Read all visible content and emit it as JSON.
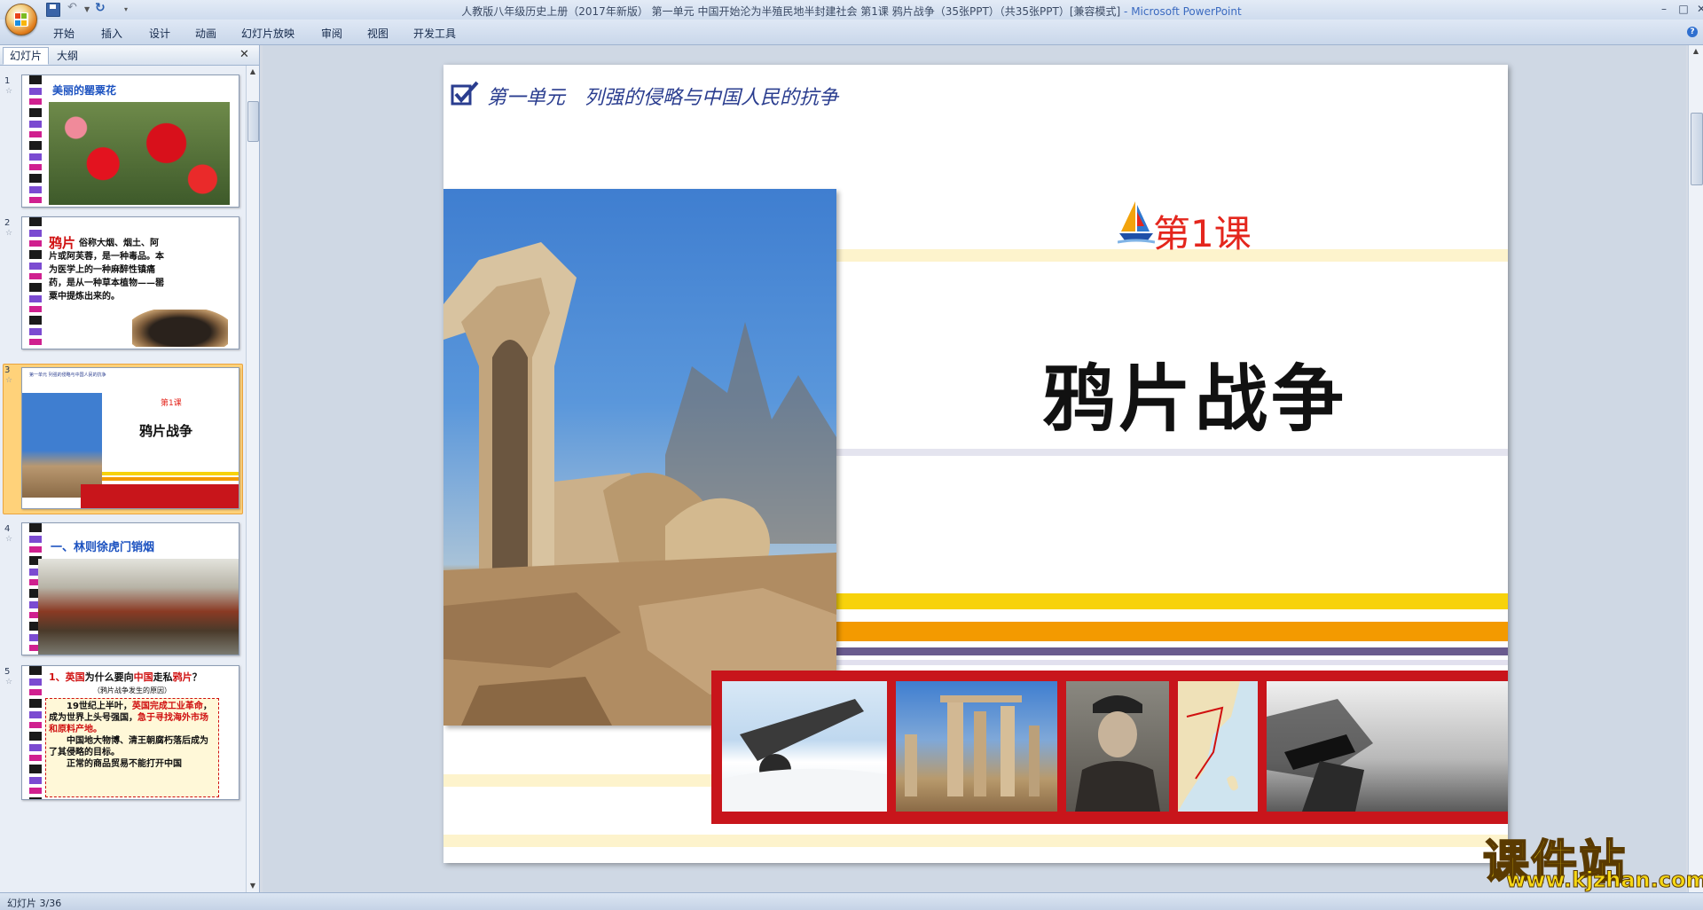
{
  "titlebar": {
    "title": "人教版八年级历史上册（2017年新版） 第一单元 中国开始沦为半殖民地半封建社会 第1课 鸦片战争（35张PPT）（共35张PPT）[兼容模式]",
    "app": " - Microsoft PowerPoint",
    "min": "–",
    "max": "□",
    "close": "✕"
  },
  "ribbon": {
    "tabs": [
      "开始",
      "插入",
      "设计",
      "动画",
      "幻灯片放映",
      "审阅",
      "视图",
      "开发工具"
    ]
  },
  "panel": {
    "tab_slides": "幻灯片",
    "tab_outline": "大纲",
    "close": "✕"
  },
  "thumbnails": [
    {
      "num": "1",
      "title": "美丽的罂粟花"
    },
    {
      "num": "2",
      "heading": "鸦片",
      "body": "俗称大烟、烟土、阿片或阿芙蓉，是一种毒品。本为医学上的一种麻醉性镇痛药，是从一种草本植物——罂粟中提炼出来的。"
    },
    {
      "num": "3",
      "unit": "第一单元 列强的侵略与中国人民的抗争",
      "lesson": "第1课",
      "title": "鸦片战争"
    },
    {
      "num": "4",
      "title": "一、林则徐虎门销烟"
    },
    {
      "num": "5",
      "q_num": "1、",
      "q_a": "英国",
      "q_b": "为什么要向",
      "q_c": "中国",
      "q_d": "走私",
      "q_e": "鸦片",
      "q_f": "？",
      "sub": "（鸦片战争发生的原因）",
      "p1a": "19世纪上半叶，",
      "p1b": "英国完成工业革命",
      "p1c": "，成为世界上头号强国，",
      "p1d": "急于寻找海外市场和原料产地。",
      "p2": "中国地大物博、清王朝腐朽落后成为了其侵略的目标。",
      "p3": "正常的商品贸易不能打开中国"
    }
  ],
  "slide": {
    "unit": "第一单元　列强的侵略与中国人民的抗争",
    "lesson": "第1课",
    "title": "鸦片战争"
  },
  "status": {
    "text": "幻灯片 3/36"
  },
  "watermark": {
    "cn": "课件站",
    "url": "www.kjzhan.com"
  }
}
